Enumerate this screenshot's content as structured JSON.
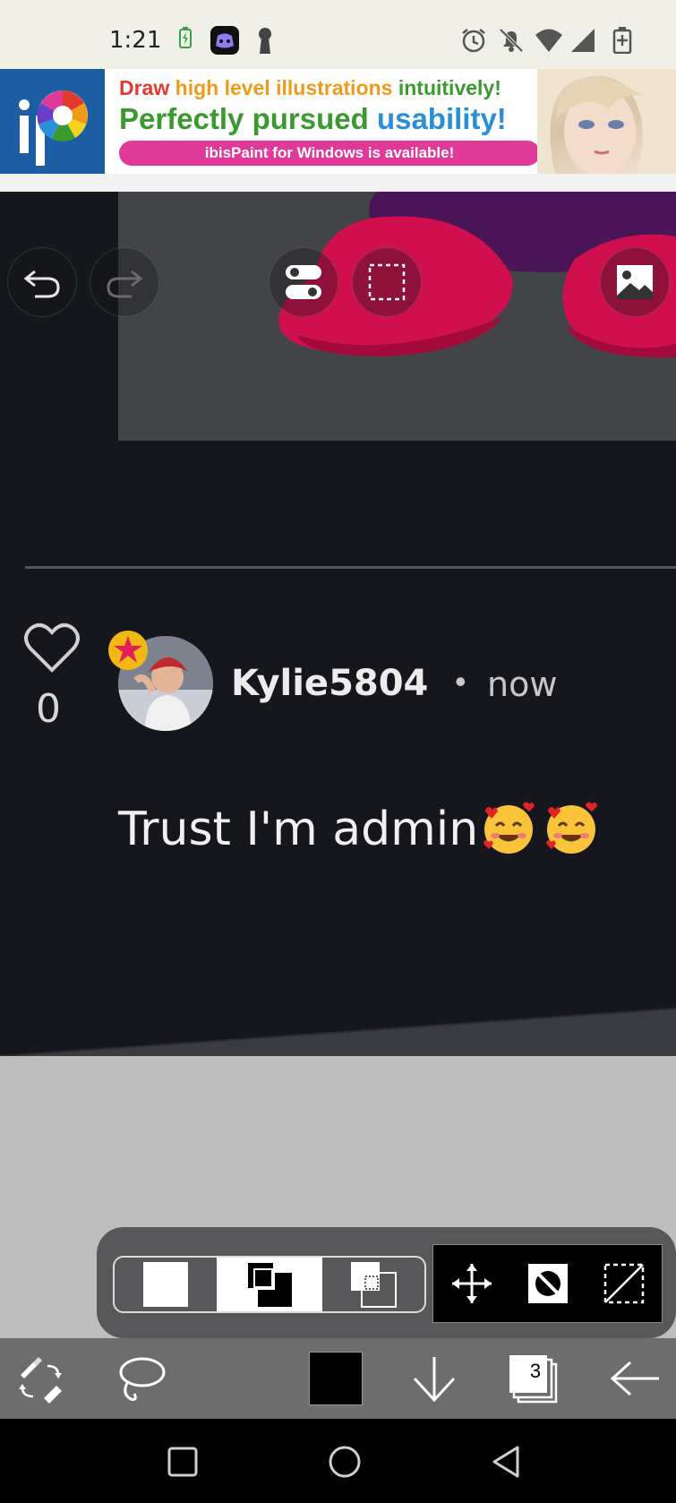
{
  "status_bar": {
    "time": "1:21"
  },
  "ad": {
    "line1": {
      "w1": "Draw",
      "w2": "high level illustrations",
      "w3": "intuitively!"
    },
    "line2": {
      "w1": "Perfectly pursued",
      "w2": "usability!"
    },
    "pill": "ibisPaint for Windows is available!",
    "colors": {
      "red": "#e23b2e",
      "orange": "#f09a1a",
      "green": "#3a9a2e",
      "blue": "#2a8fd8",
      "pink": "#e0399a"
    }
  },
  "canvas_tools": {
    "undo": "undo-icon",
    "redo": "redo-icon",
    "toggle": "toggle-icon",
    "selection": "selection-icon",
    "reference": "image-icon"
  },
  "comment": {
    "like_count": "0",
    "username": "Kylie5804",
    "separator": "•",
    "timestamp": "now",
    "text": "Trust I'm admin"
  },
  "bottom_toolbar": {
    "layer_count": "3"
  },
  "colors": {
    "canvas_bg": "#15171c",
    "toolbar_bg": "#6d6d6d",
    "panel_bg": "#58585a"
  }
}
